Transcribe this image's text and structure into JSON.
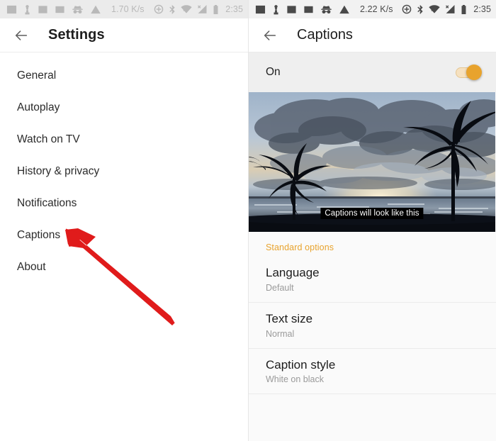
{
  "left_panel": {
    "status_bar": {
      "icons": [
        "article-icon",
        "person-icon",
        "screenshot-icon",
        "image-icon",
        "incognito-icon",
        "warning-icon"
      ],
      "network_speed": "1.70 K/s",
      "right_icons": [
        "location-icon",
        "bluetooth-icon",
        "wifi-icon",
        "signal-off-icon",
        "battery-icon"
      ],
      "clock": "2:35"
    },
    "appbar": {
      "back_icon": "back-arrow-icon",
      "title": "Settings"
    },
    "menu_items": [
      {
        "label": "General"
      },
      {
        "label": "Autoplay"
      },
      {
        "label": "Watch on TV"
      },
      {
        "label": "History & privacy"
      },
      {
        "label": "Notifications"
      },
      {
        "label": "Captions"
      },
      {
        "label": "About"
      }
    ],
    "annotation": {
      "type": "red-arrow",
      "color": "#e01b1b",
      "points_to": "Captions"
    }
  },
  "right_panel": {
    "status_bar": {
      "icons": [
        "article-icon",
        "person-icon",
        "screenshot-icon",
        "image-icon",
        "incognito-icon",
        "warning-icon"
      ],
      "network_speed": "2.22 K/s",
      "right_icons": [
        "location-icon",
        "bluetooth-icon",
        "wifi-icon",
        "signal-off-icon",
        "battery-icon"
      ],
      "clock": "2:35"
    },
    "appbar": {
      "back_icon": "back-arrow-icon",
      "title": "Captions"
    },
    "toggle": {
      "label": "On",
      "state": "on",
      "accent_color": "#e8a32d"
    },
    "preview": {
      "description": "beach-sunset-palm-trees-photo",
      "caption_text": "Captions will look like this"
    },
    "section_header": "Standard options",
    "options": [
      {
        "title": "Language",
        "value": "Default"
      },
      {
        "title": "Text size",
        "value": "Normal"
      },
      {
        "title": "Caption style",
        "value": "White on black"
      }
    ]
  }
}
